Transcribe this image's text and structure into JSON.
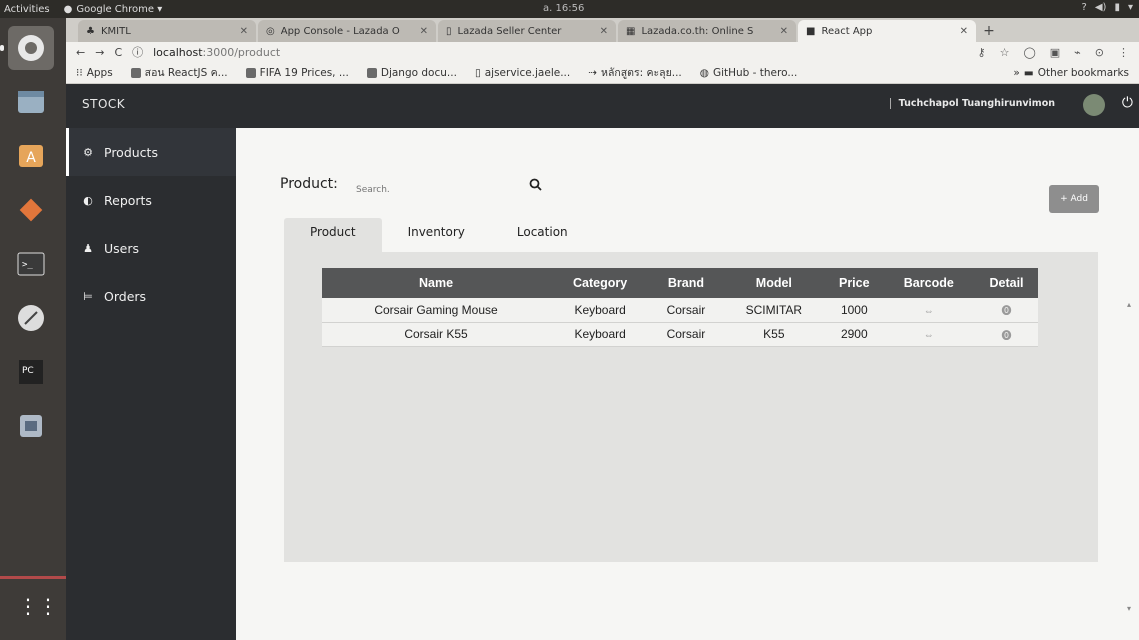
{
  "topbar": {
    "activities": "Activities",
    "app_name": "Google Chrome ▾",
    "clock": "a. 16:56",
    "tray": [
      "?",
      "◀)",
      "▮",
      "▾"
    ]
  },
  "launcher": {
    "icons": [
      "chrome-icon",
      "files-icon",
      "software-center-icon",
      "git-icon",
      "terminal-icon",
      "inkscape-icon",
      "pycharm-icon",
      "disk-icon",
      "show-apps-icon"
    ]
  },
  "browser": {
    "tabs": [
      {
        "title": "KMITL",
        "active": false
      },
      {
        "title": "App Console - Lazada O",
        "active": false
      },
      {
        "title": "Lazada Seller Center",
        "active": false
      },
      {
        "title": "Lazada.co.th: Online S",
        "active": false
      },
      {
        "title": "React App",
        "active": true
      }
    ],
    "url_host": "localhost",
    "url_path": ":3000/product",
    "bookmarks": [
      "Apps",
      "สอน ReactJS ค...",
      "FIFA 19 Prices, ...",
      "Django docu...",
      "ajservice.jaele...",
      "หลักสูตร: คะลุย...",
      "GitHub - thero..."
    ],
    "other_bookmarks": "Other bookmarks"
  },
  "app": {
    "brand": "STOCK",
    "user_name": "Tuchchapol Tuanghirunvimon",
    "nav": [
      {
        "label": "Products",
        "icon": "products-icon",
        "active": true
      },
      {
        "label": "Reports",
        "icon": "reports-icon",
        "active": false
      },
      {
        "label": "Users",
        "icon": "user-icon",
        "active": false
      },
      {
        "label": "Orders",
        "icon": "cart-icon",
        "active": false
      }
    ],
    "page_title": "Product:",
    "search_placeholder": "Search.",
    "add_label": "+ Add",
    "subtabs": [
      "Product",
      "Inventory",
      "Location"
    ],
    "table": {
      "headers": [
        "Name",
        "Category",
        "Brand",
        "Model",
        "Price",
        "Barcode",
        "Detail"
      ],
      "rows": [
        {
          "name": "Corsair Gaming Mouse",
          "category": "Keyboard",
          "brand": "Corsair",
          "model": "SCIMITAR",
          "price": "1000"
        },
        {
          "name": "Corsair K55",
          "category": "Keyboard",
          "brand": "Corsair",
          "model": "K55",
          "price": "2900"
        }
      ]
    }
  }
}
